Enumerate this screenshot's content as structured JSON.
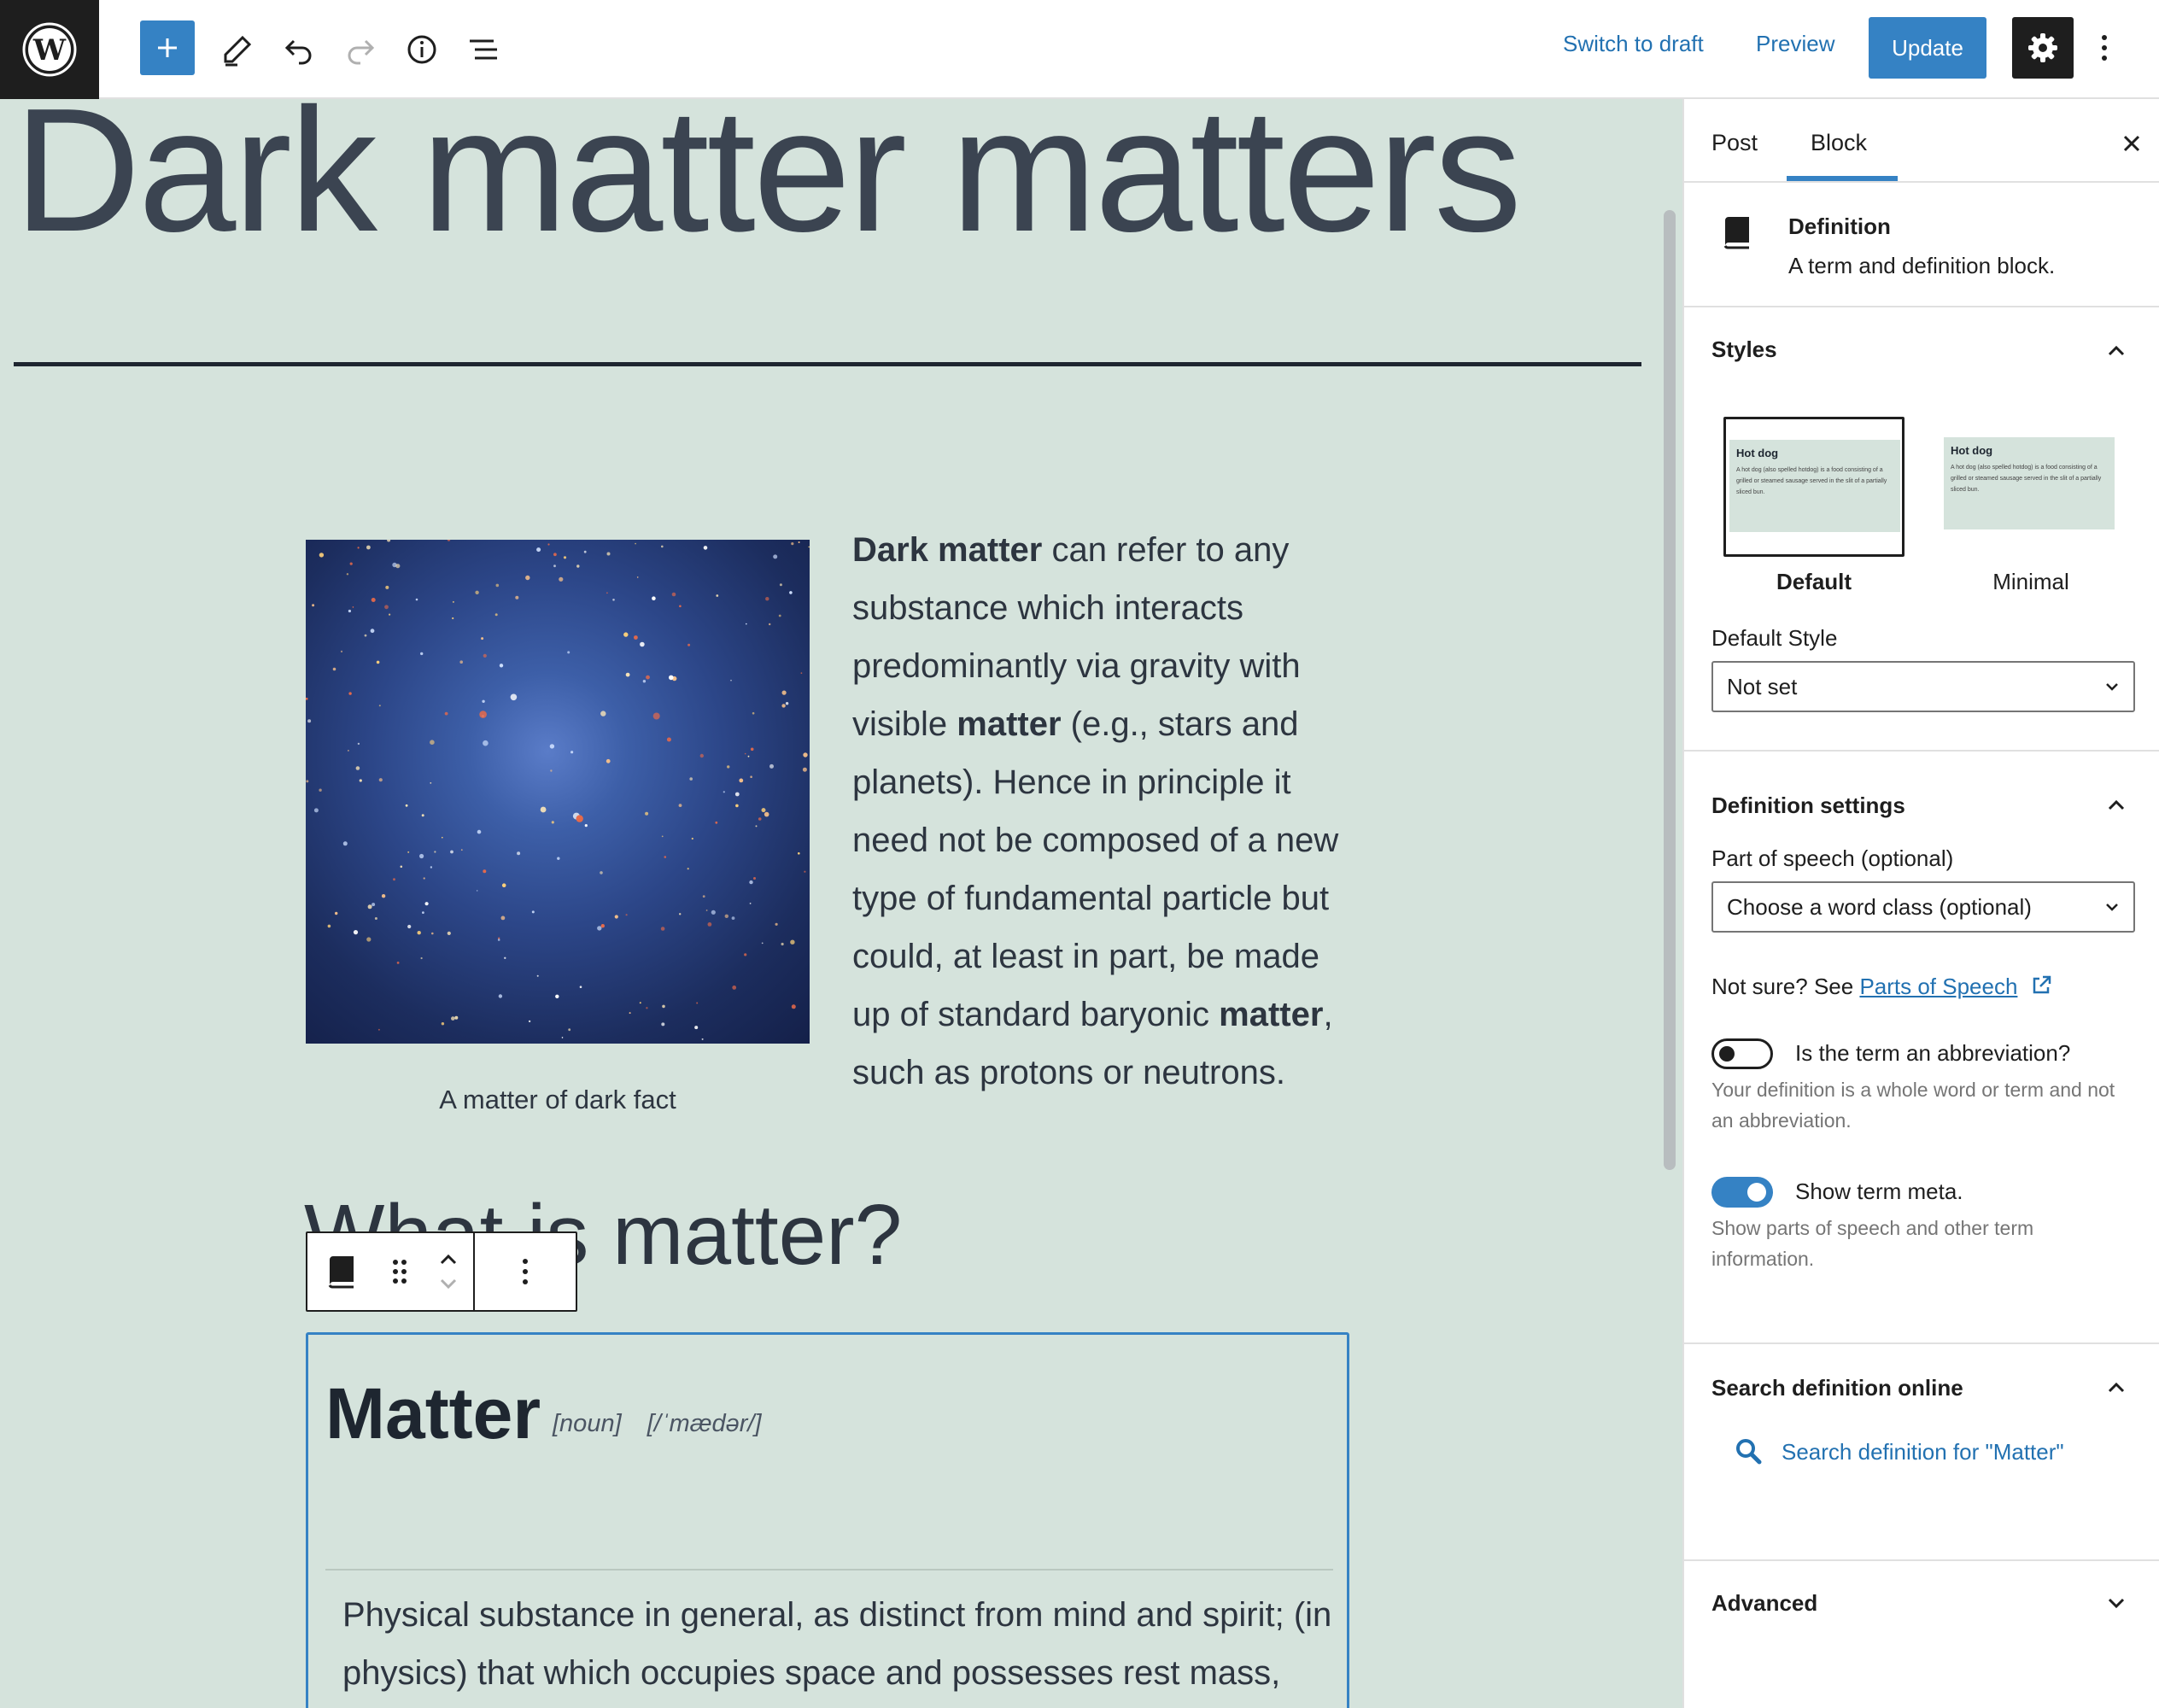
{
  "toolbar": {
    "switch_to_draft": "Switch to draft",
    "preview": "Preview",
    "update": "Update"
  },
  "canvas": {
    "post_title": "Dark matter matters",
    "image_caption": "A matter of dark fact",
    "paragraph": [
      {
        "text": "Dark matter",
        "bold": true
      },
      {
        "text": " can refer to any substance which interacts predominantly via gravity with visible ",
        "bold": false
      },
      {
        "text": "matter",
        "bold": true
      },
      {
        "text": " (e.g., stars and planets). Hence in principle it need not be composed of a new type of fundamental particle but could, at least in part, be made up of standard baryonic ",
        "bold": false
      },
      {
        "text": "matter",
        "bold": true
      },
      {
        "text": ", such as protons or neutrons.",
        "bold": false
      }
    ],
    "heading": "What is matter?",
    "definition": {
      "term": "Matter",
      "part_of_speech": "[noun]",
      "pronunciation": "[/ˈmædər/]",
      "text": "Physical substance in general, as distinct from mind and spirit; (in physics) that which occupies space and possesses rest mass, especially as distinct from energy."
    }
  },
  "sidebar": {
    "tabs": [
      "Post",
      "Block"
    ],
    "active_tab": "Block",
    "block_card": {
      "title": "Definition",
      "description": "A term and definition block."
    },
    "styles": {
      "title": "Styles",
      "options": [
        "Default",
        "Minimal"
      ],
      "selected": "Default",
      "preview_title": "Hot dog",
      "preview_text": "A hot dog (also spelled hotdog) is a food consisting of a grilled or steamed sausage served in the slit of a partially sliced bun.",
      "default_style_label": "Default Style",
      "default_style_value": "Not set"
    },
    "definition_settings": {
      "title": "Definition settings",
      "pos_label": "Part of speech (optional)",
      "pos_value": "Choose a word class (optional)",
      "not_sure_text": "Not sure? See ",
      "pos_link": "Parts of Speech",
      "abbrev_label": "Is the term an abbreviation?",
      "abbrev_on": false,
      "abbrev_help": "Your definition is a whole word or term and not an abbreviation.",
      "meta_label": "Show term meta.",
      "meta_on": true,
      "meta_help": "Show parts of speech and other term information."
    },
    "search_panel": {
      "title": "Search definition online",
      "link": "Search definition for \"Matter\""
    },
    "advanced": {
      "title": "Advanced"
    }
  },
  "colors": {
    "accent": "#3582c4",
    "canvas_bg": "#d5e3dc",
    "link": "#2271b1"
  }
}
